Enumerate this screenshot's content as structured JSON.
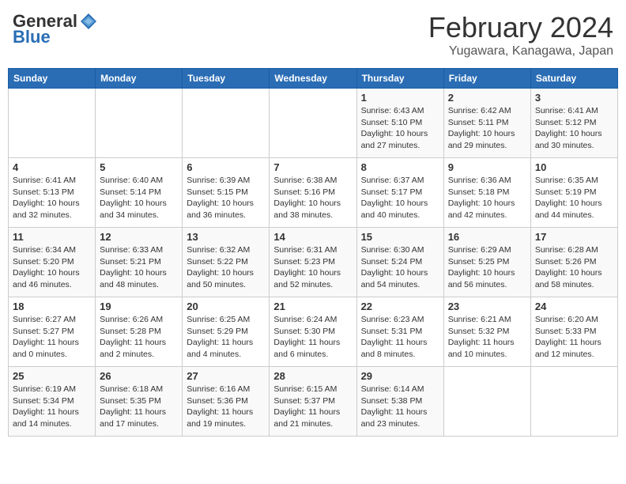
{
  "header": {
    "logo_general": "General",
    "logo_blue": "Blue",
    "title": "February 2024",
    "subtitle": "Yugawara, Kanagawa, Japan"
  },
  "weekdays": [
    "Sunday",
    "Monday",
    "Tuesday",
    "Wednesday",
    "Thursday",
    "Friday",
    "Saturday"
  ],
  "weeks": [
    [
      {
        "day": "",
        "info": ""
      },
      {
        "day": "",
        "info": ""
      },
      {
        "day": "",
        "info": ""
      },
      {
        "day": "",
        "info": ""
      },
      {
        "day": "1",
        "info": "Sunrise: 6:43 AM\nSunset: 5:10 PM\nDaylight: 10 hours and 27 minutes."
      },
      {
        "day": "2",
        "info": "Sunrise: 6:42 AM\nSunset: 5:11 PM\nDaylight: 10 hours and 29 minutes."
      },
      {
        "day": "3",
        "info": "Sunrise: 6:41 AM\nSunset: 5:12 PM\nDaylight: 10 hours and 30 minutes."
      }
    ],
    [
      {
        "day": "4",
        "info": "Sunrise: 6:41 AM\nSunset: 5:13 PM\nDaylight: 10 hours and 32 minutes."
      },
      {
        "day": "5",
        "info": "Sunrise: 6:40 AM\nSunset: 5:14 PM\nDaylight: 10 hours and 34 minutes."
      },
      {
        "day": "6",
        "info": "Sunrise: 6:39 AM\nSunset: 5:15 PM\nDaylight: 10 hours and 36 minutes."
      },
      {
        "day": "7",
        "info": "Sunrise: 6:38 AM\nSunset: 5:16 PM\nDaylight: 10 hours and 38 minutes."
      },
      {
        "day": "8",
        "info": "Sunrise: 6:37 AM\nSunset: 5:17 PM\nDaylight: 10 hours and 40 minutes."
      },
      {
        "day": "9",
        "info": "Sunrise: 6:36 AM\nSunset: 5:18 PM\nDaylight: 10 hours and 42 minutes."
      },
      {
        "day": "10",
        "info": "Sunrise: 6:35 AM\nSunset: 5:19 PM\nDaylight: 10 hours and 44 minutes."
      }
    ],
    [
      {
        "day": "11",
        "info": "Sunrise: 6:34 AM\nSunset: 5:20 PM\nDaylight: 10 hours and 46 minutes."
      },
      {
        "day": "12",
        "info": "Sunrise: 6:33 AM\nSunset: 5:21 PM\nDaylight: 10 hours and 48 minutes."
      },
      {
        "day": "13",
        "info": "Sunrise: 6:32 AM\nSunset: 5:22 PM\nDaylight: 10 hours and 50 minutes."
      },
      {
        "day": "14",
        "info": "Sunrise: 6:31 AM\nSunset: 5:23 PM\nDaylight: 10 hours and 52 minutes."
      },
      {
        "day": "15",
        "info": "Sunrise: 6:30 AM\nSunset: 5:24 PM\nDaylight: 10 hours and 54 minutes."
      },
      {
        "day": "16",
        "info": "Sunrise: 6:29 AM\nSunset: 5:25 PM\nDaylight: 10 hours and 56 minutes."
      },
      {
        "day": "17",
        "info": "Sunrise: 6:28 AM\nSunset: 5:26 PM\nDaylight: 10 hours and 58 minutes."
      }
    ],
    [
      {
        "day": "18",
        "info": "Sunrise: 6:27 AM\nSunset: 5:27 PM\nDaylight: 11 hours and 0 minutes."
      },
      {
        "day": "19",
        "info": "Sunrise: 6:26 AM\nSunset: 5:28 PM\nDaylight: 11 hours and 2 minutes."
      },
      {
        "day": "20",
        "info": "Sunrise: 6:25 AM\nSunset: 5:29 PM\nDaylight: 11 hours and 4 minutes."
      },
      {
        "day": "21",
        "info": "Sunrise: 6:24 AM\nSunset: 5:30 PM\nDaylight: 11 hours and 6 minutes."
      },
      {
        "day": "22",
        "info": "Sunrise: 6:23 AM\nSunset: 5:31 PM\nDaylight: 11 hours and 8 minutes."
      },
      {
        "day": "23",
        "info": "Sunrise: 6:21 AM\nSunset: 5:32 PM\nDaylight: 11 hours and 10 minutes."
      },
      {
        "day": "24",
        "info": "Sunrise: 6:20 AM\nSunset: 5:33 PM\nDaylight: 11 hours and 12 minutes."
      }
    ],
    [
      {
        "day": "25",
        "info": "Sunrise: 6:19 AM\nSunset: 5:34 PM\nDaylight: 11 hours and 14 minutes."
      },
      {
        "day": "26",
        "info": "Sunrise: 6:18 AM\nSunset: 5:35 PM\nDaylight: 11 hours and 17 minutes."
      },
      {
        "day": "27",
        "info": "Sunrise: 6:16 AM\nSunset: 5:36 PM\nDaylight: 11 hours and 19 minutes."
      },
      {
        "day": "28",
        "info": "Sunrise: 6:15 AM\nSunset: 5:37 PM\nDaylight: 11 hours and 21 minutes."
      },
      {
        "day": "29",
        "info": "Sunrise: 6:14 AM\nSunset: 5:38 PM\nDaylight: 11 hours and 23 minutes."
      },
      {
        "day": "",
        "info": ""
      },
      {
        "day": "",
        "info": ""
      }
    ]
  ]
}
